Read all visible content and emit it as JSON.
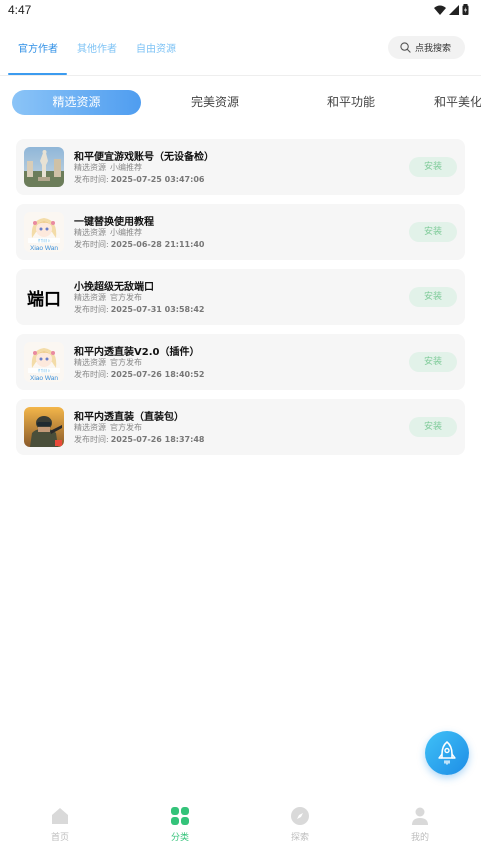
{
  "status_bar": {
    "time": "4:47"
  },
  "top_tabs": [
    {
      "label": "官方作者",
      "active": true
    },
    {
      "label": "其他作者",
      "active": false
    },
    {
      "label": "自由资源",
      "active": false
    }
  ],
  "search": {
    "label": "点我搜索"
  },
  "categories": [
    {
      "label": "精选资源",
      "active": true
    },
    {
      "label": "完美资源",
      "active": false
    },
    {
      "label": "和平功能",
      "active": false
    },
    {
      "label": "和平美化",
      "active": false
    }
  ],
  "items": [
    {
      "title": "和平便宜游戏账号（无设备检）",
      "tag": "精选资源",
      "source": "小编推荐",
      "date_label": "发布时间:",
      "date": "2025-07-25 03:47:06",
      "action": "安装",
      "thumb_icon": "sculpture-thumbnail-icon"
    },
    {
      "title": "一键替换使用教程",
      "tag": "精选资源",
      "source": "小编推荐",
      "date_label": "发布时间:",
      "date": "2025-06-28 21:11:40",
      "action": "安装",
      "thumb_icon": "anime-girl-thumbnail-icon",
      "thumb_text": "Xiao Wan"
    },
    {
      "title": "小挽超级无敌端口",
      "tag": "精选资源",
      "source": "官方发布",
      "date_label": "发布时间:",
      "date": "2025-07-31 03:58:42",
      "action": "安装",
      "thumb_text": "端口"
    },
    {
      "title": "和平内透直装V2.0（插件）",
      "tag": "精选资源",
      "source": "官方发布",
      "date_label": "发布时间:",
      "date": "2025-07-26 18:40:52",
      "action": "安装",
      "thumb_icon": "anime-girl-thumbnail-icon",
      "thumb_text": "Xiao Wan"
    },
    {
      "title": "和平内透直装（直装包）",
      "tag": "精选资源",
      "source": "官方发布",
      "date_label": "发布时间:",
      "date": "2025-07-26 18:37:48",
      "action": "安装",
      "thumb_icon": "game-soldier-thumbnail-icon"
    }
  ],
  "fab": {
    "icon": "rocket-icon"
  },
  "bottom_nav": [
    {
      "label": "首页",
      "icon": "home-icon",
      "active": false
    },
    {
      "label": "分类",
      "icon": "grid-icon",
      "active": true
    },
    {
      "label": "探索",
      "icon": "compass-icon",
      "active": false
    },
    {
      "label": "我的",
      "icon": "user-icon",
      "active": false
    }
  ],
  "colors": {
    "accent_blue": "#2f8fe6",
    "accent_green": "#34c37a",
    "install_bg": "#e2f2e9",
    "install_text": "#7fcb99"
  }
}
